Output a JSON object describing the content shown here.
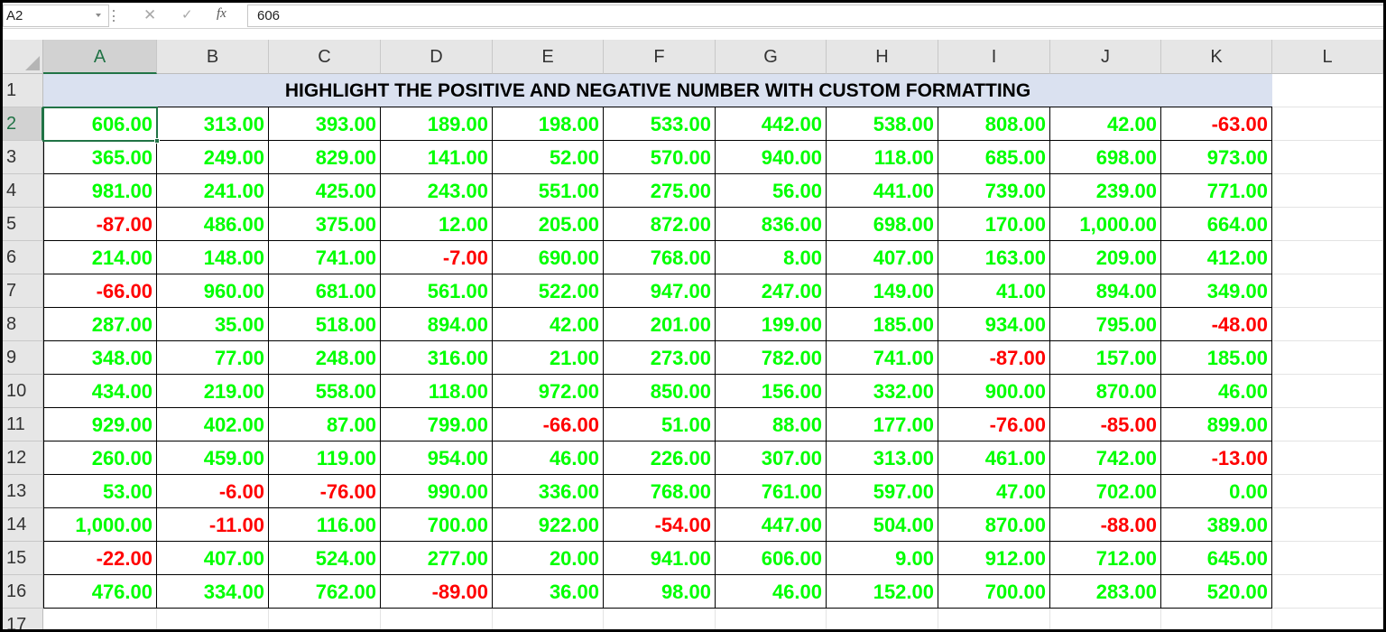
{
  "formula_bar": {
    "name_box": "A2",
    "cancel_icon": "✕",
    "enter_icon": "✓",
    "function_icon": "fx",
    "formula_value": "606"
  },
  "sheet": {
    "columns": [
      "A",
      "B",
      "C",
      "D",
      "E",
      "F",
      "G",
      "H",
      "I",
      "J",
      "K",
      "L"
    ],
    "rows": [
      "1",
      "2",
      "3",
      "4",
      "5",
      "6",
      "7",
      "8",
      "9",
      "10",
      "11",
      "12",
      "13",
      "14",
      "15",
      "16",
      "17"
    ],
    "title": "HIGHLIGHT THE POSITIVE AND NEGATIVE NUMBER WITH CUSTOM FORMATTING",
    "selected_cell": "A2",
    "positive_color": "#00ff00",
    "negative_color": "#ff0000",
    "header_fill": "#dae1f0",
    "data": [
      [
        "606.00",
        "313.00",
        "393.00",
        "189.00",
        "198.00",
        "533.00",
        "442.00",
        "538.00",
        "808.00",
        "42.00",
        "-63.00"
      ],
      [
        "365.00",
        "249.00",
        "829.00",
        "141.00",
        "52.00",
        "570.00",
        "940.00",
        "118.00",
        "685.00",
        "698.00",
        "973.00"
      ],
      [
        "981.00",
        "241.00",
        "425.00",
        "243.00",
        "551.00",
        "275.00",
        "56.00",
        "441.00",
        "739.00",
        "239.00",
        "771.00"
      ],
      [
        "-87.00",
        "486.00",
        "375.00",
        "12.00",
        "205.00",
        "872.00",
        "836.00",
        "698.00",
        "170.00",
        "1,000.00",
        "664.00"
      ],
      [
        "214.00",
        "148.00",
        "741.00",
        "-7.00",
        "690.00",
        "768.00",
        "8.00",
        "407.00",
        "163.00",
        "209.00",
        "412.00"
      ],
      [
        "-66.00",
        "960.00",
        "681.00",
        "561.00",
        "522.00",
        "947.00",
        "247.00",
        "149.00",
        "41.00",
        "894.00",
        "349.00"
      ],
      [
        "287.00",
        "35.00",
        "518.00",
        "894.00",
        "42.00",
        "201.00",
        "199.00",
        "185.00",
        "934.00",
        "795.00",
        "-48.00"
      ],
      [
        "348.00",
        "77.00",
        "248.00",
        "316.00",
        "21.00",
        "273.00",
        "782.00",
        "741.00",
        "-87.00",
        "157.00",
        "185.00"
      ],
      [
        "434.00",
        "219.00",
        "558.00",
        "118.00",
        "972.00",
        "850.00",
        "156.00",
        "332.00",
        "900.00",
        "870.00",
        "46.00"
      ],
      [
        "929.00",
        "402.00",
        "87.00",
        "799.00",
        "-66.00",
        "51.00",
        "88.00",
        "177.00",
        "-76.00",
        "-85.00",
        "899.00"
      ],
      [
        "260.00",
        "459.00",
        "119.00",
        "954.00",
        "46.00",
        "226.00",
        "307.00",
        "313.00",
        "461.00",
        "742.00",
        "-13.00"
      ],
      [
        "53.00",
        "-6.00",
        "-76.00",
        "990.00",
        "336.00",
        "768.00",
        "761.00",
        "597.00",
        "47.00",
        "702.00",
        "0.00"
      ],
      [
        "1,000.00",
        "-11.00",
        "116.00",
        "700.00",
        "922.00",
        "-54.00",
        "447.00",
        "504.00",
        "870.00",
        "-88.00",
        "389.00"
      ],
      [
        "-22.00",
        "407.00",
        "524.00",
        "277.00",
        "20.00",
        "941.00",
        "606.00",
        "9.00",
        "912.00",
        "712.00",
        "645.00"
      ],
      [
        "476.00",
        "334.00",
        "762.00",
        "-89.00",
        "36.00",
        "98.00",
        "46.00",
        "152.00",
        "700.00",
        "283.00",
        "520.00"
      ]
    ]
  }
}
